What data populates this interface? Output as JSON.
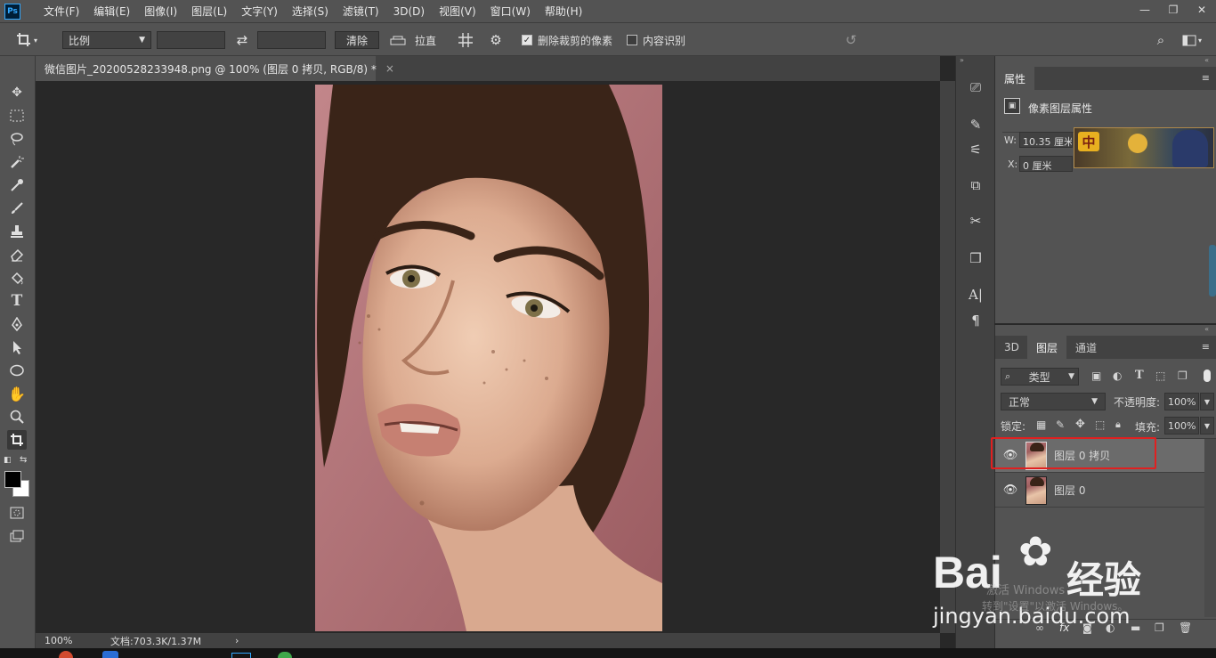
{
  "app": {
    "logo": "Ps"
  },
  "menu": [
    "文件(F)",
    "编辑(E)",
    "图像(I)",
    "图层(L)",
    "文字(Y)",
    "选择(S)",
    "滤镜(T)",
    "3D(D)",
    "视图(V)",
    "窗口(W)",
    "帮助(H)"
  ],
  "window_controls": {
    "minimize": "—",
    "restore": "❐",
    "close": "✕"
  },
  "options": {
    "ratio_select": "比例",
    "clear_label": "清除",
    "straighten_label": "拉直",
    "delete_cropped": {
      "label": "删除裁剪的像素",
      "checked": true
    },
    "content_aware": {
      "label": "内容识别",
      "checked": false
    }
  },
  "document_tab": {
    "title": "微信图片_20200528233948.png @ 100% (图层 0 拷贝, RGB/8) *",
    "close": "×"
  },
  "status": {
    "zoom": "100%",
    "doc_info": "文档:703.3K/1.37M",
    "arrow": "›"
  },
  "properties": {
    "tab_label": "属性",
    "subtitle": "像素图层属性",
    "w_label": "W:",
    "w_value": "10.35 厘米",
    "x_label": "X:",
    "x_value": "0 厘米",
    "ad_text": "中"
  },
  "layers_panel": {
    "tabs": [
      "3D",
      "图层",
      "通道"
    ],
    "active_tab": "图层",
    "filter_select": "类型",
    "blend_mode": "正常",
    "opacity_label": "不透明度:",
    "opacity_value": "100%",
    "lock_label": "锁定:",
    "fill_label": "填充:",
    "fill_value": "100%",
    "layers": [
      {
        "name": "图层 0 拷贝",
        "visible": true,
        "selected": true
      },
      {
        "name": "图层 0",
        "visible": true,
        "selected": false
      }
    ],
    "footer_fx": "fx"
  },
  "watermark": {
    "brand": "Bai",
    "brand_cn": "经验",
    "url": "jingyan.baidu.com",
    "activate_line1": "激活 Windows",
    "activate_line2": "转到\"设置\"以激活 Windows。"
  },
  "colors": {
    "panel_bg": "#535353",
    "dark_bg": "#282828",
    "tab_bg": "#424242",
    "selection_outline": "#e02020",
    "ps_blue": "#31a8ff"
  }
}
